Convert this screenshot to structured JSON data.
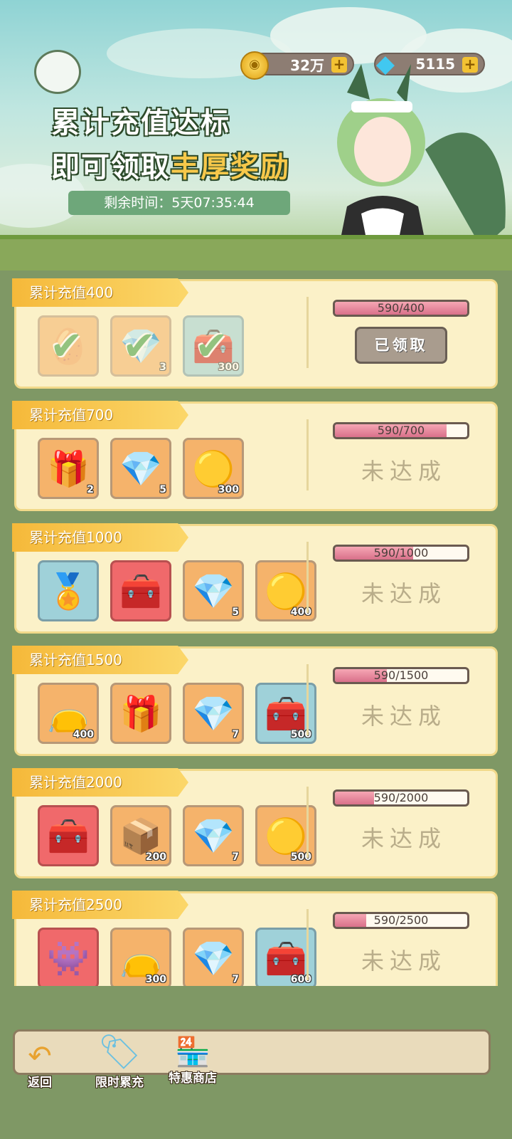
{
  "header": {
    "coins": "32万",
    "gems": "5115",
    "plus_symbol": "+",
    "headline_line1": "累计充值达标",
    "headline_line2_prefix": "即可领取",
    "headline_line2_highlight": "丰厚奖励",
    "timer_label": "剩余时间：",
    "timer_value": "5天07:35:44"
  },
  "tiers": [
    {
      "title": "累计充值400",
      "progress_text": "590/400",
      "progress": 1.0,
      "status": "已领取",
      "claimed": true,
      "items": [
        {
          "icon": "egg-icon",
          "count": ""
        },
        {
          "icon": "crystal-icon",
          "count": "3"
        },
        {
          "icon": "treasure-chest-icon",
          "count": "300"
        }
      ]
    },
    {
      "title": "累计充值700",
      "progress_text": "590/700",
      "progress": 0.843,
      "status": "未达成",
      "claimed": false,
      "items": [
        {
          "icon": "gold-chest-icon",
          "count": "2"
        },
        {
          "icon": "blue-crystal-icon",
          "count": "5"
        },
        {
          "icon": "gold-fruit-icon",
          "count": "300"
        }
      ]
    },
    {
      "title": "累计充值1000",
      "progress_text": "590/1000",
      "progress": 0.59,
      "status": "未达成",
      "claimed": false,
      "items": [
        {
          "icon": "badge-icon",
          "count": ""
        },
        {
          "icon": "red-chest-icon",
          "count": ""
        },
        {
          "icon": "blue-crystal-icon",
          "count": "5"
        },
        {
          "icon": "gold-fruit-icon",
          "count": "400"
        }
      ]
    },
    {
      "title": "累计充值1500",
      "progress_text": "590/1500",
      "progress": 0.393,
      "status": "未达成",
      "claimed": false,
      "items": [
        {
          "icon": "purple-bag-icon",
          "count": "400"
        },
        {
          "icon": "gold-chest-icon",
          "count": ""
        },
        {
          "icon": "blue-crystal-icon",
          "count": "7"
        },
        {
          "icon": "treasure-chest-icon",
          "count": "500"
        }
      ]
    },
    {
      "title": "累计充值2000",
      "progress_text": "590/2000",
      "progress": 0.295,
      "status": "未达成",
      "claimed": false,
      "items": [
        {
          "icon": "red-chest-icon",
          "count": ""
        },
        {
          "icon": "wood-chest-icon",
          "count": "200"
        },
        {
          "icon": "blue-crystal-icon",
          "count": "7"
        },
        {
          "icon": "gold-fruit-icon",
          "count": "500"
        }
      ]
    },
    {
      "title": "累计充值2500",
      "progress_text": "590/2500",
      "progress": 0.236,
      "status": "未达成",
      "claimed": false,
      "items": [
        {
          "icon": "monster-chest-icon",
          "count": ""
        },
        {
          "icon": "purple-bag-icon",
          "count": "300"
        },
        {
          "icon": "blue-crystal-icon",
          "count": "7"
        },
        {
          "icon": "treasure-chest-icon",
          "count": "600"
        }
      ]
    }
  ],
  "bottom_nav": {
    "back_label": "返回",
    "recharge_label": "限时累充",
    "shop_label": "特惠商店"
  }
}
